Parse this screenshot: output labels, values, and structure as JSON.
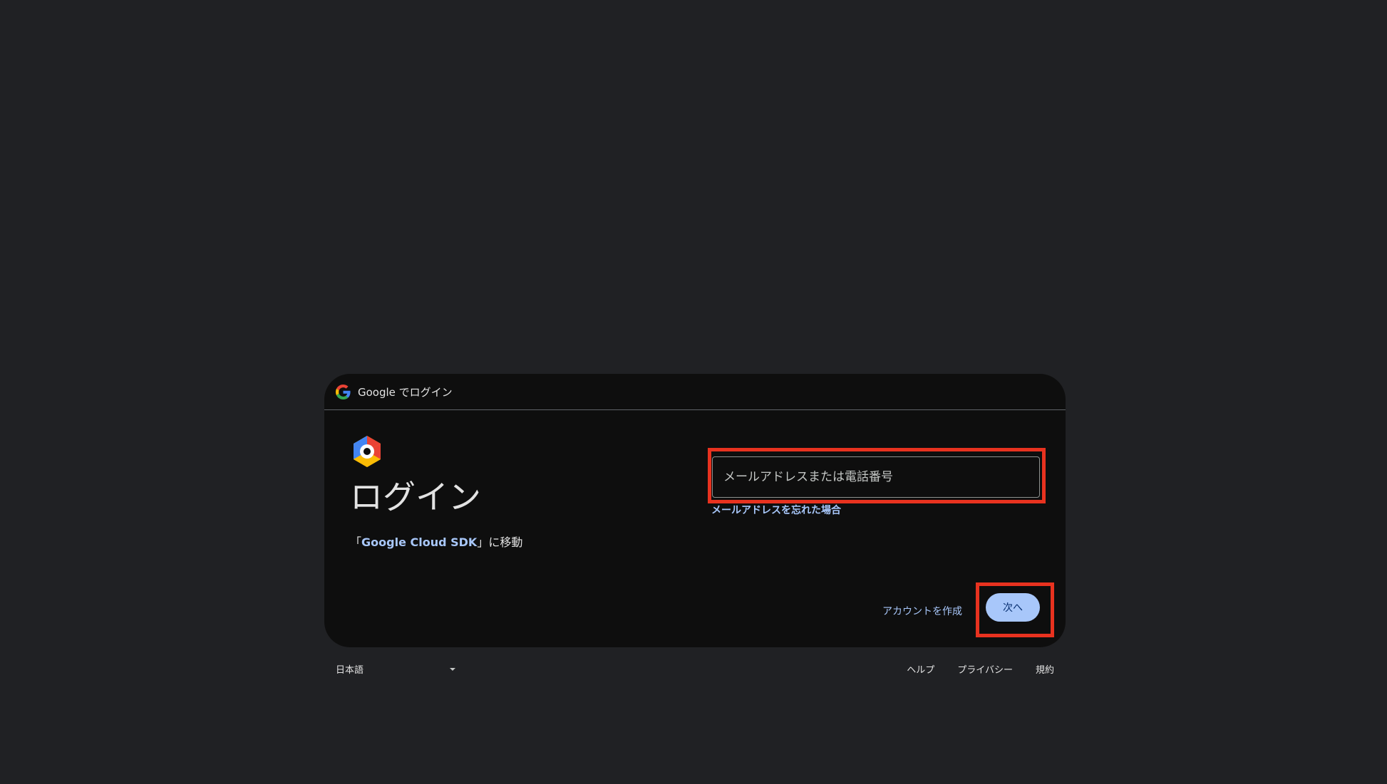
{
  "header": {
    "title": "Google でログイン",
    "logo_icon": "google-g-icon"
  },
  "main": {
    "app_icon": "google-cloud-icon",
    "title": "ログイン",
    "subtitle_prefix": "「",
    "app_name": "Google Cloud SDK",
    "subtitle_suffix": "」に移動"
  },
  "form": {
    "email_placeholder": "メールアドレスまたは電話番号",
    "email_value": "",
    "forgot_email": "メールアドレスを忘れた場合"
  },
  "actions": {
    "create_account": "アカウントを作成",
    "next": "次へ"
  },
  "footer": {
    "language": "日本語",
    "links": [
      "ヘルプ",
      "プライバシー",
      "規約"
    ]
  },
  "colors": {
    "page_background": "#202124",
    "card_background": "#0e0e0e",
    "accent": "#a8c7fa",
    "highlight_border": "#e8321f"
  }
}
